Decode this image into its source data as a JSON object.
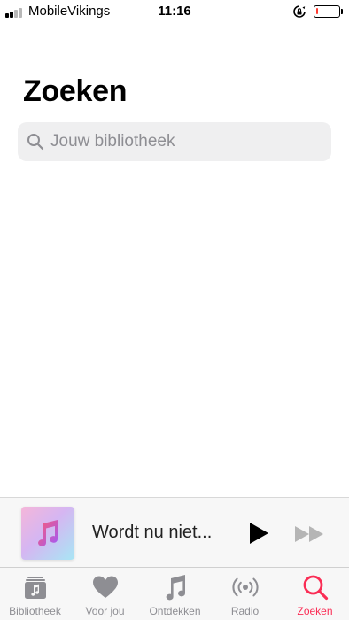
{
  "status_bar": {
    "carrier": "MobileVikings",
    "time": "11:16",
    "battery_level": 0.1
  },
  "page": {
    "title": "Zoeken"
  },
  "search": {
    "placeholder": "Jouw bibliotheek"
  },
  "mini_player": {
    "title": "Wordt nu niet..."
  },
  "tab_bar": {
    "items": [
      {
        "label": "Bibliotheek",
        "icon": "library-icon",
        "active": false
      },
      {
        "label": "Voor jou",
        "icon": "heart-icon",
        "active": false
      },
      {
        "label": "Ontdekken",
        "icon": "music-note-icon",
        "active": false
      },
      {
        "label": "Radio",
        "icon": "radio-icon",
        "active": false
      },
      {
        "label": "Zoeken",
        "icon": "search-icon",
        "active": true
      }
    ]
  },
  "colors": {
    "accent": "#fa2d55",
    "inactive": "#8e8e93",
    "battery_low": "#ff3b30"
  }
}
